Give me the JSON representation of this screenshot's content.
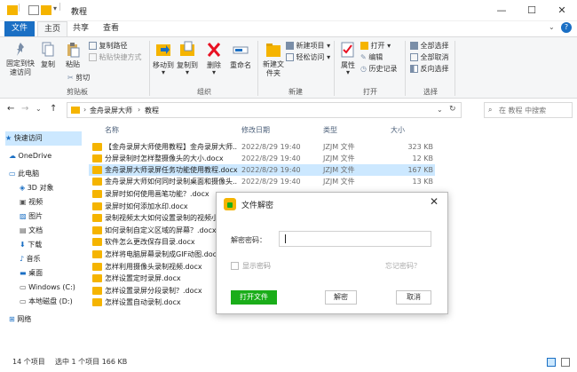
{
  "window": {
    "title": "教程"
  },
  "ribbon_tabs": {
    "file": "文件",
    "home": "主页",
    "share": "共享",
    "view": "查看"
  },
  "ribbon": {
    "pin": "固定到快速访问",
    "copy": "复制",
    "paste": "粘贴",
    "copy_path": "复制路径",
    "paste_shortcut": "粘贴快捷方式",
    "cut": "剪切",
    "clipboard_group": "剪贴板",
    "move_to": "移动到",
    "copy_to": "复制到",
    "delete": "删除",
    "rename": "重命名",
    "organize_group": "组织",
    "new_folder": "新建文件夹",
    "new_item": "新建项目",
    "easy_access": "轻松访问",
    "new_group": "新建",
    "properties": "属性",
    "open": "打开",
    "edit": "编辑",
    "history": "历史记录",
    "open_group": "打开",
    "select_all": "全部选择",
    "select_none": "全部取消",
    "invert_selection": "反向选择",
    "select_group": "选择"
  },
  "address": {
    "crumbs": [
      "金舟录屏大师",
      "教程"
    ],
    "search_placeholder": "在 教程 中搜索"
  },
  "nav": [
    {
      "label": "快速访问",
      "icon": "star-icon"
    },
    {
      "label": "OneDrive",
      "icon": "cloud-icon"
    },
    {
      "label": "此电脑",
      "icon": "computer-icon"
    },
    {
      "label": "3D 对象",
      "icon": "cube-icon"
    },
    {
      "label": "视频",
      "icon": "video-icon"
    },
    {
      "label": "图片",
      "icon": "picture-icon"
    },
    {
      "label": "文档",
      "icon": "document-icon"
    },
    {
      "label": "下载",
      "icon": "download-icon"
    },
    {
      "label": "音乐",
      "icon": "music-icon"
    },
    {
      "label": "桌面",
      "icon": "desktop-icon"
    },
    {
      "label": "Windows (C:)",
      "icon": "drive-icon"
    },
    {
      "label": "本地磁盘 (D:)",
      "icon": "drive-icon"
    },
    {
      "label": "网络",
      "icon": "network-icon"
    }
  ],
  "columns": {
    "name": "名称",
    "date": "修改日期",
    "type": "类型",
    "size": "大小"
  },
  "files": [
    {
      "name": "【金舟录屏大师使用教程】金舟录屏大师...",
      "date": "2022/8/29 19:40",
      "type": "JZJM 文件",
      "size": "323 KB"
    },
    {
      "name": "分屏录制时怎样整摄像头的大小.docx",
      "date": "2022/8/29 19:40",
      "type": "JZJM 文件",
      "size": "12 KB"
    },
    {
      "name": "金舟录屏大师录屏任务功能使用教程.docx",
      "date": "2022/8/29 19:40",
      "type": "JZJM 文件",
      "size": "167 KB"
    },
    {
      "name": "金舟录屏大师如何同时录制桌面和摄像头...",
      "date": "2022/8/29 19:40",
      "type": "JZJM 文件",
      "size": "13 KB"
    },
    {
      "name": "录屏时如何使用画笔功能？.docx",
      "date": "",
      "type": "",
      "size": ""
    },
    {
      "name": "录屏时如何添加水印.docx",
      "date": "",
      "type": "",
      "size": ""
    },
    {
      "name": "录制视频太大如何设置录制的视频小...",
      "date": "",
      "type": "",
      "size": ""
    },
    {
      "name": "如何录制自定义区域的屏幕？.docx",
      "date": "",
      "type": "",
      "size": ""
    },
    {
      "name": "软件怎么更改保存目录.docx",
      "date": "",
      "type": "",
      "size": ""
    },
    {
      "name": "怎样将电脑屏幕录制成GIF动图.docx",
      "date": "",
      "type": "",
      "size": ""
    },
    {
      "name": "怎样利用摄像头录制视频.docx",
      "date": "",
      "type": "",
      "size": ""
    },
    {
      "name": "怎样设置定时录屏.docx",
      "date": "",
      "type": "",
      "size": ""
    },
    {
      "name": "怎样设置录屏分段录制？.docx",
      "date": "",
      "type": "",
      "size": ""
    },
    {
      "name": "怎样设置自动录制.docx",
      "date": "",
      "type": "",
      "size": ""
    }
  ],
  "status": {
    "count": "14 个项目",
    "selected": "选中 1 个项目  166 KB"
  },
  "dialog": {
    "title": "文件解密",
    "password_label": "解密密码：",
    "password_value": "",
    "show_password": "显示密码",
    "forgot": "忘记密码？",
    "open_file": "打开文件",
    "decrypt": "解密",
    "cancel": "取消"
  },
  "colors": {
    "accent": "#1a6fc4",
    "green": "#1aad19",
    "folder": "#f5b400",
    "selected_row": "#cce8ff"
  }
}
